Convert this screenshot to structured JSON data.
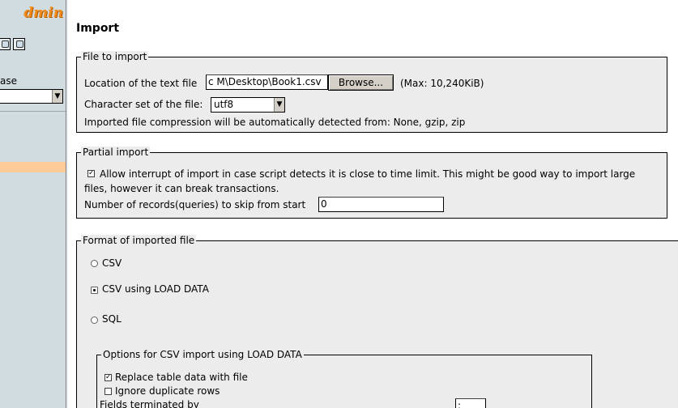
{
  "left_frame": {
    "logo_text": "dmin",
    "db_label": "ase",
    "db_select_value": ""
  },
  "main": {
    "title": "Import",
    "file_to_import": {
      "legend": "File to import",
      "location_label": "Location of the text file",
      "location_value": "c M\\Desktop\\Book1.csv",
      "browse_label": "Browse...",
      "max_size": "(Max: 10,240KiB)",
      "charset_label": "Character set of the file:",
      "charset_value": "utf8",
      "compression_note": "Imported file compression will be automatically detected from: None, gzip, zip"
    },
    "partial_import": {
      "legend": "Partial import",
      "allow_interrupt_text_line1": "Allow interrupt of import in case script detects it is close to time limit. This might be good way to import large",
      "allow_interrupt_text_line2": "files, however it can break transactions.",
      "allow_interrupt_checked": true,
      "skip_label": "Number of records(queries) to skip from start",
      "skip_value": "0"
    },
    "format": {
      "legend": "Format of imported file",
      "options": [
        {
          "label": "CSV",
          "selected": false
        },
        {
          "label": "CSV using LOAD DATA",
          "selected": true
        },
        {
          "label": "SQL",
          "selected": false
        }
      ]
    },
    "csv_load_data_options": {
      "legend": "Options for CSV import using LOAD DATA",
      "replace_label": "Replace table data with file",
      "replace_checked": true,
      "ignore_label": "Ignore duplicate rows",
      "ignore_checked": false,
      "fields_terminated_label": "Fields terminated by",
      "fields_terminated_value": ";"
    }
  },
  "colors": {
    "left_frame_bg": "#d0dce0",
    "fieldset_bg": "#ececec",
    "logo_orange": "#f08a1a",
    "highlight_row": "#ffcc99"
  }
}
